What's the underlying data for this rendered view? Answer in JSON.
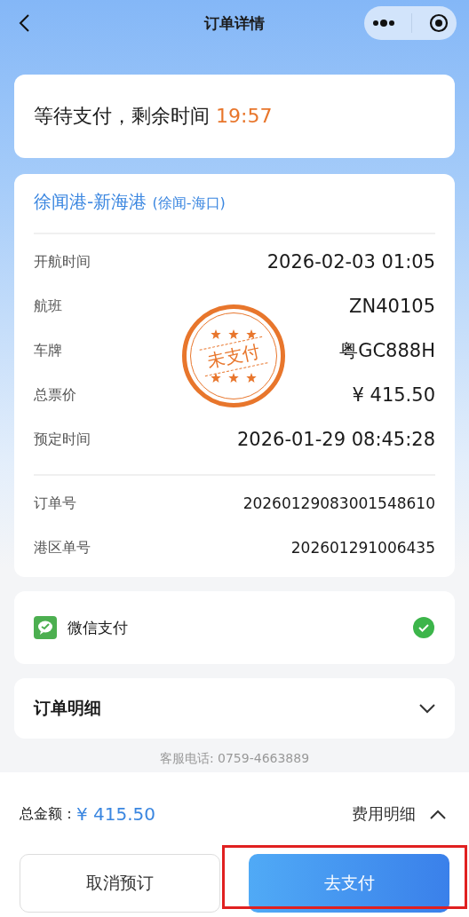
{
  "nav_bar": {
    "title": "订单详情"
  },
  "status_card": {
    "text": "等待支付，剩余时间",
    "countdown": "19:57"
  },
  "order_card": {
    "route": "徐闻港-新海港",
    "route_note": "(徐闻-海口)",
    "details": [
      {
        "label": "开航时间",
        "value": "2026-02-03 01:05"
      },
      {
        "label": "航班",
        "value": "ZN40105"
      },
      {
        "label": "车牌",
        "value": "粤GC888H"
      },
      {
        "label": "总票价",
        "value": "¥ 415.50"
      },
      {
        "label": "预定时间",
        "value": "2026-01-29 08:45:28"
      }
    ],
    "numbers": [
      {
        "label": "订单号",
        "value": "20260129083001548610"
      },
      {
        "label": "港区单号",
        "value": "202601291006435"
      }
    ],
    "stamp": "未支付"
  },
  "payment": {
    "method": "微信支付",
    "selected": true
  },
  "order_detail": {
    "title": "订单明细",
    "expanded": false
  },
  "service_phone": "客服电话: 0759-4663889",
  "footer": {
    "total_label": "总金额：",
    "total": "¥ 415.50",
    "fee_detail": "费用明细",
    "fee_expanded": false,
    "buttons": [
      {
        "kind": "secondary",
        "label": "取消预订",
        "highlighted": false
      },
      {
        "kind": "primary",
        "label": "去支付",
        "highlighted": true
      }
    ]
  }
}
